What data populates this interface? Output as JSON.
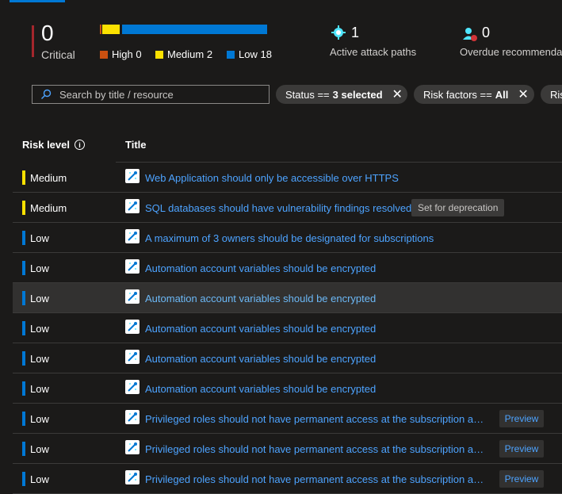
{
  "summary": {
    "critical": {
      "count": "0",
      "label": "Critical"
    },
    "legend": [
      {
        "label": "High 0",
        "color": "#ca5010"
      },
      {
        "label": "Medium 2",
        "color": "#fce100"
      },
      {
        "label": "Low 18",
        "color": "#0078d4"
      }
    ],
    "attack_paths": {
      "count": "1",
      "label": "Active attack paths"
    },
    "overdue": {
      "count": "0",
      "label": "Overdue recommendatio"
    }
  },
  "search": {
    "placeholder": "Search by title / resource"
  },
  "filters": [
    {
      "prefix": "Status ==",
      "value": "3 selected"
    },
    {
      "prefix": "Risk factors ==",
      "value": "All"
    },
    {
      "prefix": "Ris",
      "value": ""
    }
  ],
  "table": {
    "headers": {
      "risk": "Risk level",
      "title": "Title"
    },
    "rows": [
      {
        "risk": "Medium",
        "title": "Web Application should only be accessible over HTTPS",
        "badge": ""
      },
      {
        "risk": "Medium",
        "title": "SQL databases should have vulnerability findings resolved",
        "badge": "Set for deprecation"
      },
      {
        "risk": "Low",
        "title": "A maximum of 3 owners should be designated for subscriptions",
        "badge": ""
      },
      {
        "risk": "Low",
        "title": "Automation account variables should be encrypted",
        "badge": ""
      },
      {
        "risk": "Low",
        "title": "Automation account variables should be encrypted",
        "badge": ""
      },
      {
        "risk": "Low",
        "title": "Automation account variables should be encrypted",
        "badge": ""
      },
      {
        "risk": "Low",
        "title": "Automation account variables should be encrypted",
        "badge": ""
      },
      {
        "risk": "Low",
        "title": "Automation account variables should be encrypted",
        "badge": ""
      },
      {
        "risk": "Low",
        "title": "Privileged roles should not have permanent access at the subscription and ...",
        "badge": "Preview"
      },
      {
        "risk": "Low",
        "title": "Privileged roles should not have permanent access at the subscription and ...",
        "badge": "Preview"
      },
      {
        "risk": "Low",
        "title": "Privileged roles should not have permanent access at the subscription and ...",
        "badge": "Preview"
      }
    ]
  },
  "colors": {
    "medium": "#fce100",
    "low": "#0078d4",
    "critical": "#a4262c",
    "link": "#4da3ff"
  },
  "icons": {
    "search": "search-icon",
    "attack_paths": "attack-path-icon",
    "overdue": "user-alert-icon",
    "recommendation": "recommendation-icon",
    "close": "close-icon",
    "info": "info-icon"
  }
}
